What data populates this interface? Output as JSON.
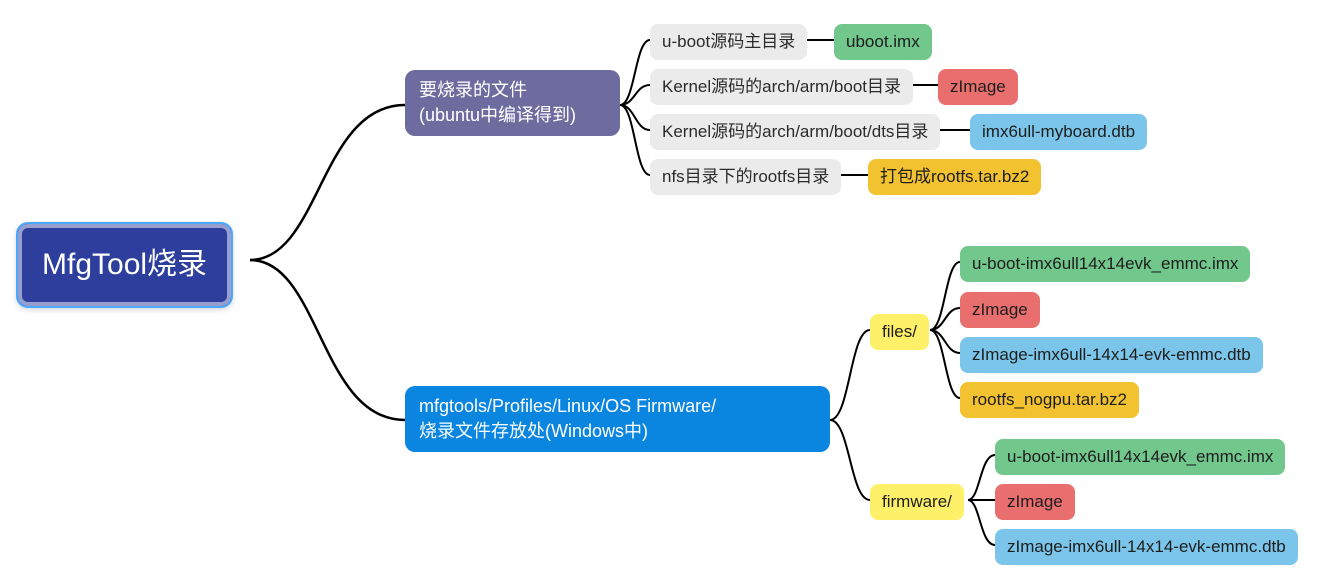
{
  "root": {
    "title": "MfgTool烧录"
  },
  "branch1": {
    "title": "要烧录的文件\n(ubuntu中编译得到)",
    "items": [
      {
        "src": "u-boot源码主目录",
        "out": "uboot.imx"
      },
      {
        "src": "Kernel源码的arch/arm/boot目录",
        "out": "zImage"
      },
      {
        "src": "Kernel源码的arch/arm/boot/dts目录",
        "out": "imx6ull-myboard.dtb"
      },
      {
        "src": "nfs目录下的rootfs目录",
        "out": "打包成rootfs.tar.bz2"
      }
    ]
  },
  "branch2": {
    "title": "mfgtools/Profiles/Linux/OS Firmware/\n烧录文件存放处(Windows中)",
    "groups": [
      {
        "name": "files/",
        "items": [
          "u-boot-imx6ull14x14evk_emmc.imx",
          "zImage",
          "zImage-imx6ull-14x14-evk-emmc.dtb",
          "rootfs_nogpu.tar.bz2"
        ]
      },
      {
        "name": "firmware/",
        "items": [
          "u-boot-imx6ull14x14evk_emmc.imx",
          "zImage",
          "zImage-imx6ull-14x14-evk-emmc.dtb"
        ]
      }
    ]
  },
  "colors": {
    "root": "#2e3e9c",
    "purple": "#6e6c9e",
    "blue": "#0a85e0",
    "gray": "#ebebeb",
    "green": "#72c78c",
    "red": "#e96e6e",
    "sky": "#7ac5e9",
    "gold": "#f2c230",
    "yellow": "#fff06a"
  }
}
